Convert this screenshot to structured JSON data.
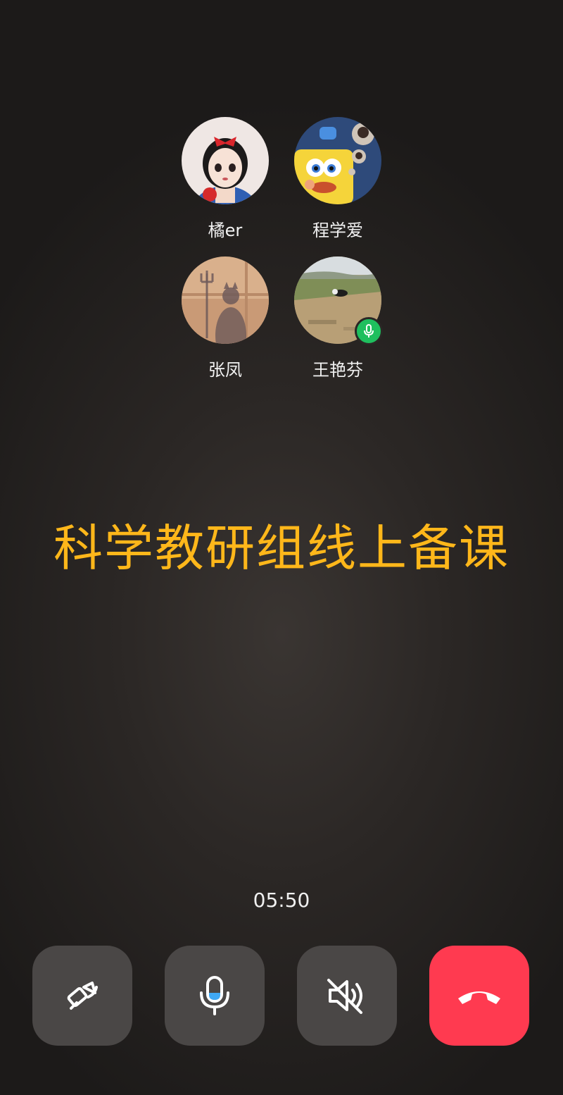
{
  "participants": [
    {
      "name": "橘er",
      "avatar": "cartoon-princess-avatar",
      "speaking": false
    },
    {
      "name": "程学爱",
      "avatar": "sponge-cartoon-avatar",
      "speaking": false
    },
    {
      "name": "张凤",
      "avatar": "shadow-silhouette-avatar",
      "speaking": false
    },
    {
      "name": "王艳芬",
      "avatar": "field-landscape-avatar",
      "speaking": true
    }
  ],
  "meeting": {
    "title": "科学教研组线上备课",
    "elapsed": "05:50"
  },
  "controls": [
    {
      "id": "video",
      "icon": "camera-off-icon"
    },
    {
      "id": "mic",
      "icon": "microphone-icon"
    },
    {
      "id": "speaker",
      "icon": "speaker-muted-icon"
    },
    {
      "id": "hangup",
      "icon": "hang-up-icon"
    }
  ],
  "colors": {
    "title": "#ffb71a",
    "hangup": "#ff3a50",
    "speaking_badge": "#1fbf5e",
    "control_bg": "#4a4746",
    "mic_fill": "#3fa9f5"
  }
}
